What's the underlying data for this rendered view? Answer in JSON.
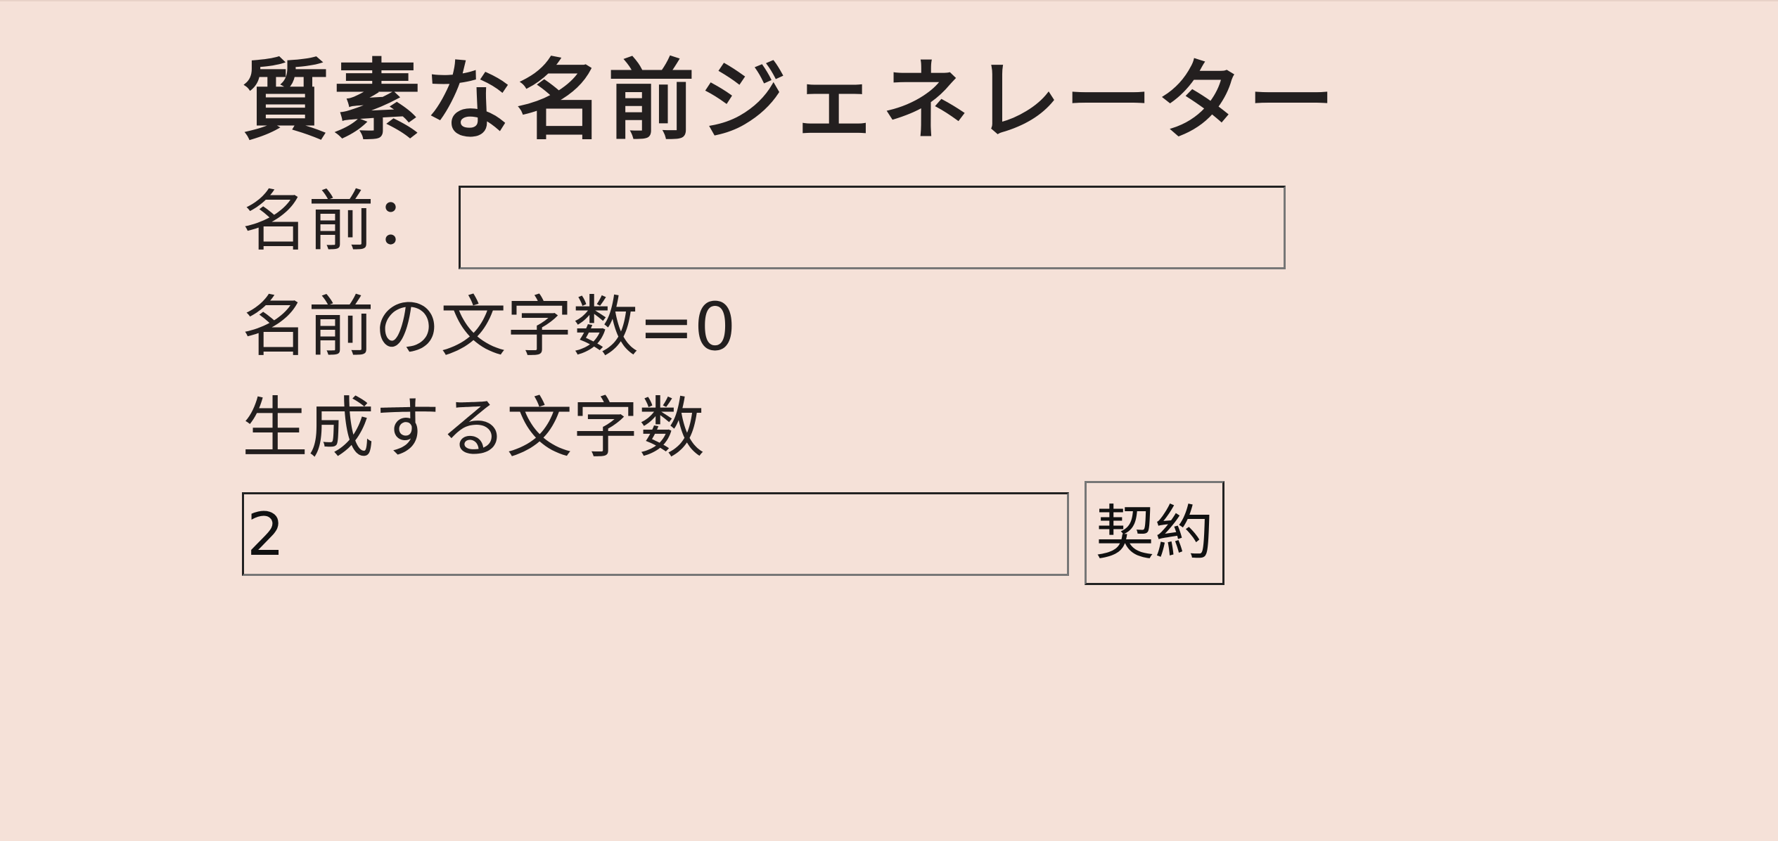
{
  "title": "質素な名前ジェネレーター",
  "name_label": "名前：",
  "name_input": {
    "value": "",
    "placeholder": ""
  },
  "name_count": {
    "label": "名前の文字数=",
    "value": "0"
  },
  "generate_count_label": "生成する文字数",
  "generate_count_input": {
    "value": "2"
  },
  "generate_button_label": "契約"
}
